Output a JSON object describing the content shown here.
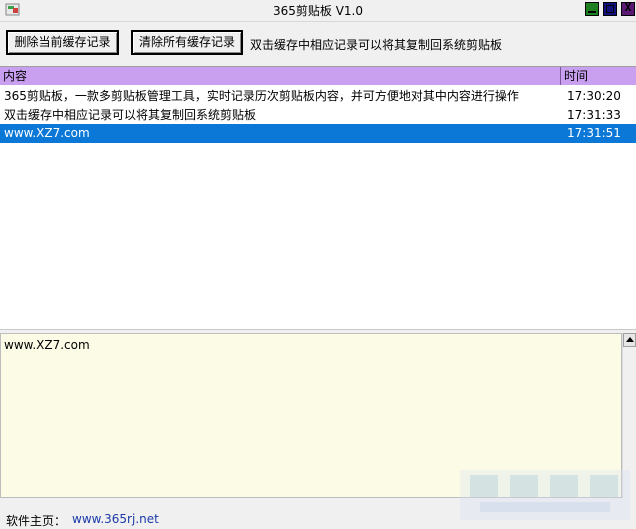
{
  "window": {
    "title": "365剪贴板 V1.0",
    "controls": {
      "minimize_icon": "minimize-icon",
      "maximize_icon": "maximize-icon",
      "close_glyph": "X"
    }
  },
  "toolbar": {
    "delete_current_label": "删除当前缓存记录",
    "clear_all_label": "清除所有缓存记录",
    "hint": "双击缓存中相应记录可以将其复制回系统剪贴板"
  },
  "list": {
    "columns": {
      "content": "内容",
      "time": "时间"
    },
    "rows": [
      {
        "content": "365剪贴板，一款多剪贴板管理工具，实时记录历次剪贴板内容，并可方便地对其中内容进行操作",
        "time": "17:30:20",
        "selected": false
      },
      {
        "content": "双击缓存中相应记录可以将其复制回系统剪贴板",
        "time": "17:31:33",
        "selected": false
      },
      {
        "content": "www.XZ7.com",
        "time": "17:31:51",
        "selected": true
      }
    ]
  },
  "preview": {
    "text": "www.XZ7.com"
  },
  "status": {
    "label": "软件主页：",
    "link": "www.365rj.net"
  },
  "colors": {
    "header_bg": "#c9a0f0",
    "selection_bg": "#0b78d7",
    "preview_bg": "#fcfce6",
    "link": "#1a3aa8",
    "min_btn": "#1e7f1e",
    "max_btn": "#10107a",
    "close_btn": "#5a1a74"
  },
  "icons": [
    "app-icon",
    "minimize-icon",
    "maximize-icon",
    "close-icon",
    "scroll-up-arrow-icon"
  ]
}
